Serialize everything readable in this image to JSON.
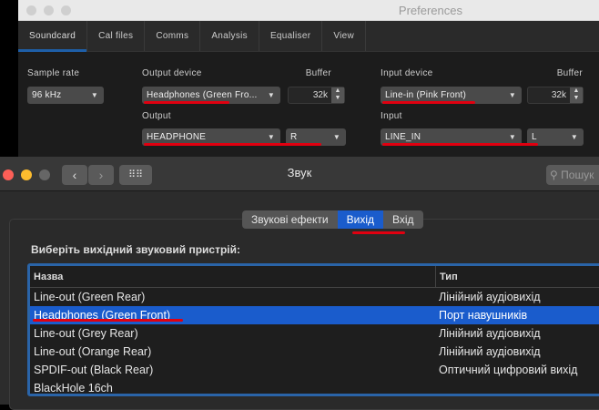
{
  "prefs": {
    "title": "Preferences",
    "tabs": [
      "Soundcard",
      "Cal files",
      "Comms",
      "Analysis",
      "Equaliser",
      "View"
    ],
    "sample_rate_label": "Sample rate",
    "sample_rate": "96 kHz",
    "output_device_label": "Output device",
    "output_device": "Headphones (Green Fro...",
    "out_buffer_label": "Buffer",
    "out_buffer": "32k",
    "output_label": "Output",
    "output": "HEADPHONE",
    "output_channel": "R",
    "input_device_label": "Input device",
    "input_device": "Line-in (Pink Front)",
    "in_buffer_label": "Buffer",
    "in_buffer": "32k",
    "input_label": "Input",
    "input": "LINE_IN",
    "input_channel": "L"
  },
  "sound": {
    "title": "Звук",
    "search_placeholder": "Пошук",
    "tabs": [
      "Звукові ефекти",
      "Вихід",
      "Вхід"
    ],
    "active_tab": "Вихід",
    "prompt": "Виберіть вихідний звуковий пристрій:",
    "columns": [
      "Назва",
      "Тип"
    ],
    "rows": [
      [
        "Line-out (Green Rear)",
        "Лінійний аудіовихід"
      ],
      [
        "Headphones (Green Front)",
        "Порт навушників"
      ],
      [
        "Line-out (Grey Rear)",
        "Лінійний аудіовихід"
      ],
      [
        "Line-out (Orange Rear)",
        "Лінійний аудіовихід"
      ],
      [
        "SPDIF-out (Black Rear)",
        "Оптичний цифровий вихід"
      ],
      [
        "BlackHole 16ch",
        ""
      ]
    ],
    "selected_row": 1
  },
  "colors": {
    "accent": "#1a5ccc",
    "highlight": "#e00010"
  }
}
